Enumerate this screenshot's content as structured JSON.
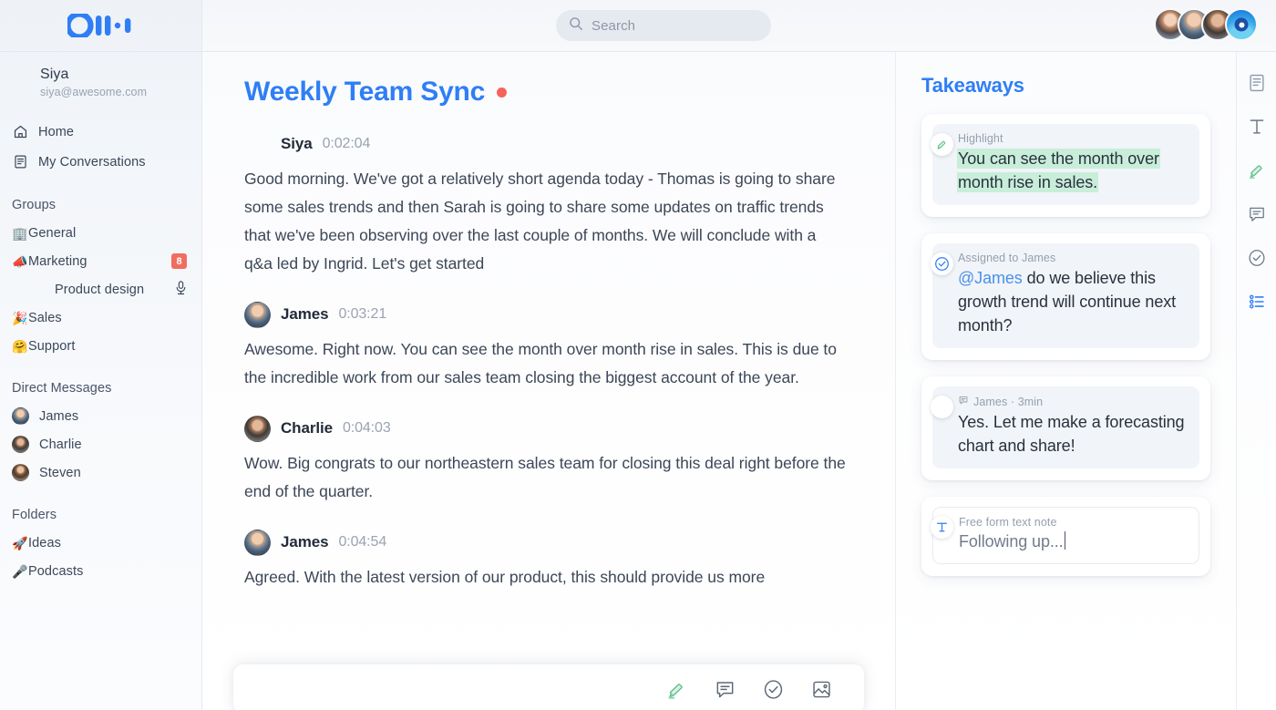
{
  "brand": {
    "accent_blue": "#2f7ef5",
    "record_red": "#f4635a",
    "badge_red": "#ef6d61",
    "highlight_green": "#c8eeda",
    "highlighter_icon_green": "#5bbd87"
  },
  "sidebar": {
    "logo_name": "otter-logo",
    "user": {
      "name": "Siya",
      "email": "siya@awesome.com"
    },
    "nav": [
      {
        "label": "Home",
        "icon": "home-icon"
      },
      {
        "label": "My Conversations",
        "icon": "conversations-icon"
      }
    ],
    "groups": {
      "title": "Groups",
      "items": [
        {
          "label": "General",
          "emoji": "🏢",
          "badge": "",
          "sub": false,
          "mic": false
        },
        {
          "label": "Marketing",
          "emoji": "📣",
          "badge": "8",
          "sub": false,
          "mic": false
        },
        {
          "label": "Product design",
          "emoji": "",
          "badge": "",
          "sub": true,
          "mic": true
        },
        {
          "label": "Sales",
          "emoji": "🎉",
          "badge": "",
          "sub": false,
          "mic": false
        },
        {
          "label": "Support",
          "emoji": "🤗",
          "badge": "",
          "sub": false,
          "mic": false
        }
      ]
    },
    "direct_messages": {
      "title": "Direct Messages",
      "items": [
        {
          "label": "James",
          "avatar": "av-james"
        },
        {
          "label": "Charlie",
          "avatar": "av-charlie"
        },
        {
          "label": "Steven",
          "avatar": "av-steven"
        }
      ]
    },
    "folders": {
      "title": "Folders",
      "items": [
        {
          "label": "Ideas",
          "emoji": "🚀"
        },
        {
          "label": "Podcasts",
          "emoji": "🎤"
        }
      ]
    }
  },
  "topbar": {
    "search_placeholder": "Search",
    "search_value": "",
    "avatars": [
      "av-siya",
      "av-james",
      "av-charlie",
      "camera-avatar"
    ]
  },
  "transcript": {
    "title": "Weekly Team Sync",
    "recording": true,
    "segments": [
      {
        "speaker": "Siya",
        "timestamp": "0:02:04",
        "avatar": "",
        "text": "Good morning. We've got a relatively short agenda today - Thomas is going to share some sales trends and then Sarah is going to share some updates on traffic trends that we've been observing over the last couple of months. We will conclude with a q&a led by Ingrid. Let's get started"
      },
      {
        "speaker": "James",
        "timestamp": "0:03:21",
        "avatar": "av-james",
        "text": "Awesome. Right now. You can see the month over month rise in sales. This is due to the incredible work from our sales team closing the biggest account of the year."
      },
      {
        "speaker": "Charlie",
        "timestamp": "0:04:03",
        "avatar": "av-charlie",
        "text": "Wow. Big congrats to our northeastern sales team for closing this deal right before the end of the quarter."
      },
      {
        "speaker": "James",
        "timestamp": "0:04:54",
        "avatar": "av-james",
        "text": "Agreed. With the latest version of our product, this should provide us more"
      }
    ],
    "bottom_toolbar": [
      {
        "icon": "highlighter-icon"
      },
      {
        "icon": "comment-icon"
      },
      {
        "icon": "action-item-icon"
      },
      {
        "icon": "image-icon"
      }
    ]
  },
  "takeaways": {
    "title": "Takeaways",
    "cards": [
      {
        "type": "highlight",
        "icon": "highlighter-icon",
        "kicker": "Highlight",
        "lines": [
          "You can see the month over",
          "month rise in sales."
        ]
      },
      {
        "type": "action_item",
        "icon": "action-item-icon",
        "kicker": "Assigned to James",
        "mention": "@James",
        "text": " do we believe this growth trend will continue next month?"
      },
      {
        "type": "comment",
        "icon": "comment-icon",
        "avatar": "av-james",
        "kicker": "James · 3min",
        "text": "Yes. Let me make a forecasting chart and share!"
      },
      {
        "type": "text_note",
        "icon": "text-note-icon",
        "kicker": "Free form text note",
        "value": "Following up...",
        "placeholder": "Free form text note"
      }
    ]
  },
  "rail": {
    "items": [
      {
        "icon": "document-icon",
        "active": false
      },
      {
        "icon": "text-icon",
        "active": false
      },
      {
        "icon": "highlighter-icon",
        "active": false
      },
      {
        "icon": "comment-icon",
        "active": false
      },
      {
        "icon": "action-item-icon",
        "active": false
      },
      {
        "icon": "takeaways-list-icon",
        "active": true
      }
    ]
  }
}
